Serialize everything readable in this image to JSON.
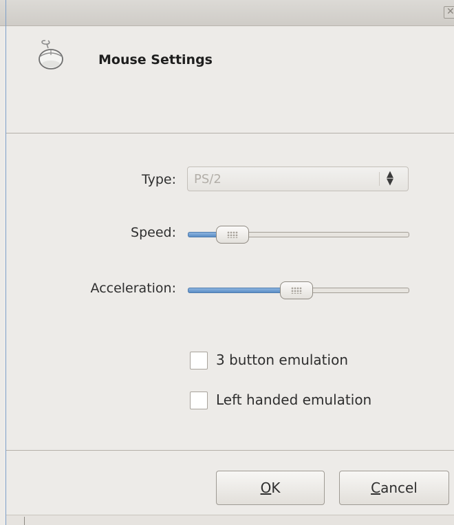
{
  "dialog": {
    "title": "Mouse Settings",
    "icon": "mouse-icon",
    "close_icon": "close-icon"
  },
  "type_field": {
    "label": "Type:",
    "value": "PS/2",
    "enabled": false,
    "arrow_up": "▲",
    "arrow_down": "▼"
  },
  "speed": {
    "label": "Speed:",
    "value_fraction": 0.15
  },
  "acceleration": {
    "label": "Acceleration:",
    "value_fraction": 0.49
  },
  "options": [
    {
      "label": "3 button emulation",
      "checked": false
    },
    {
      "label": "Left handed emulation",
      "checked": false
    }
  ],
  "buttons": {
    "ok_mnemonic": "O",
    "ok_rest": "K",
    "cancel_mnemonic": "C",
    "cancel_rest": "ancel"
  },
  "colors": {
    "accent": "#5a8dc6",
    "background": "#edebe8"
  }
}
